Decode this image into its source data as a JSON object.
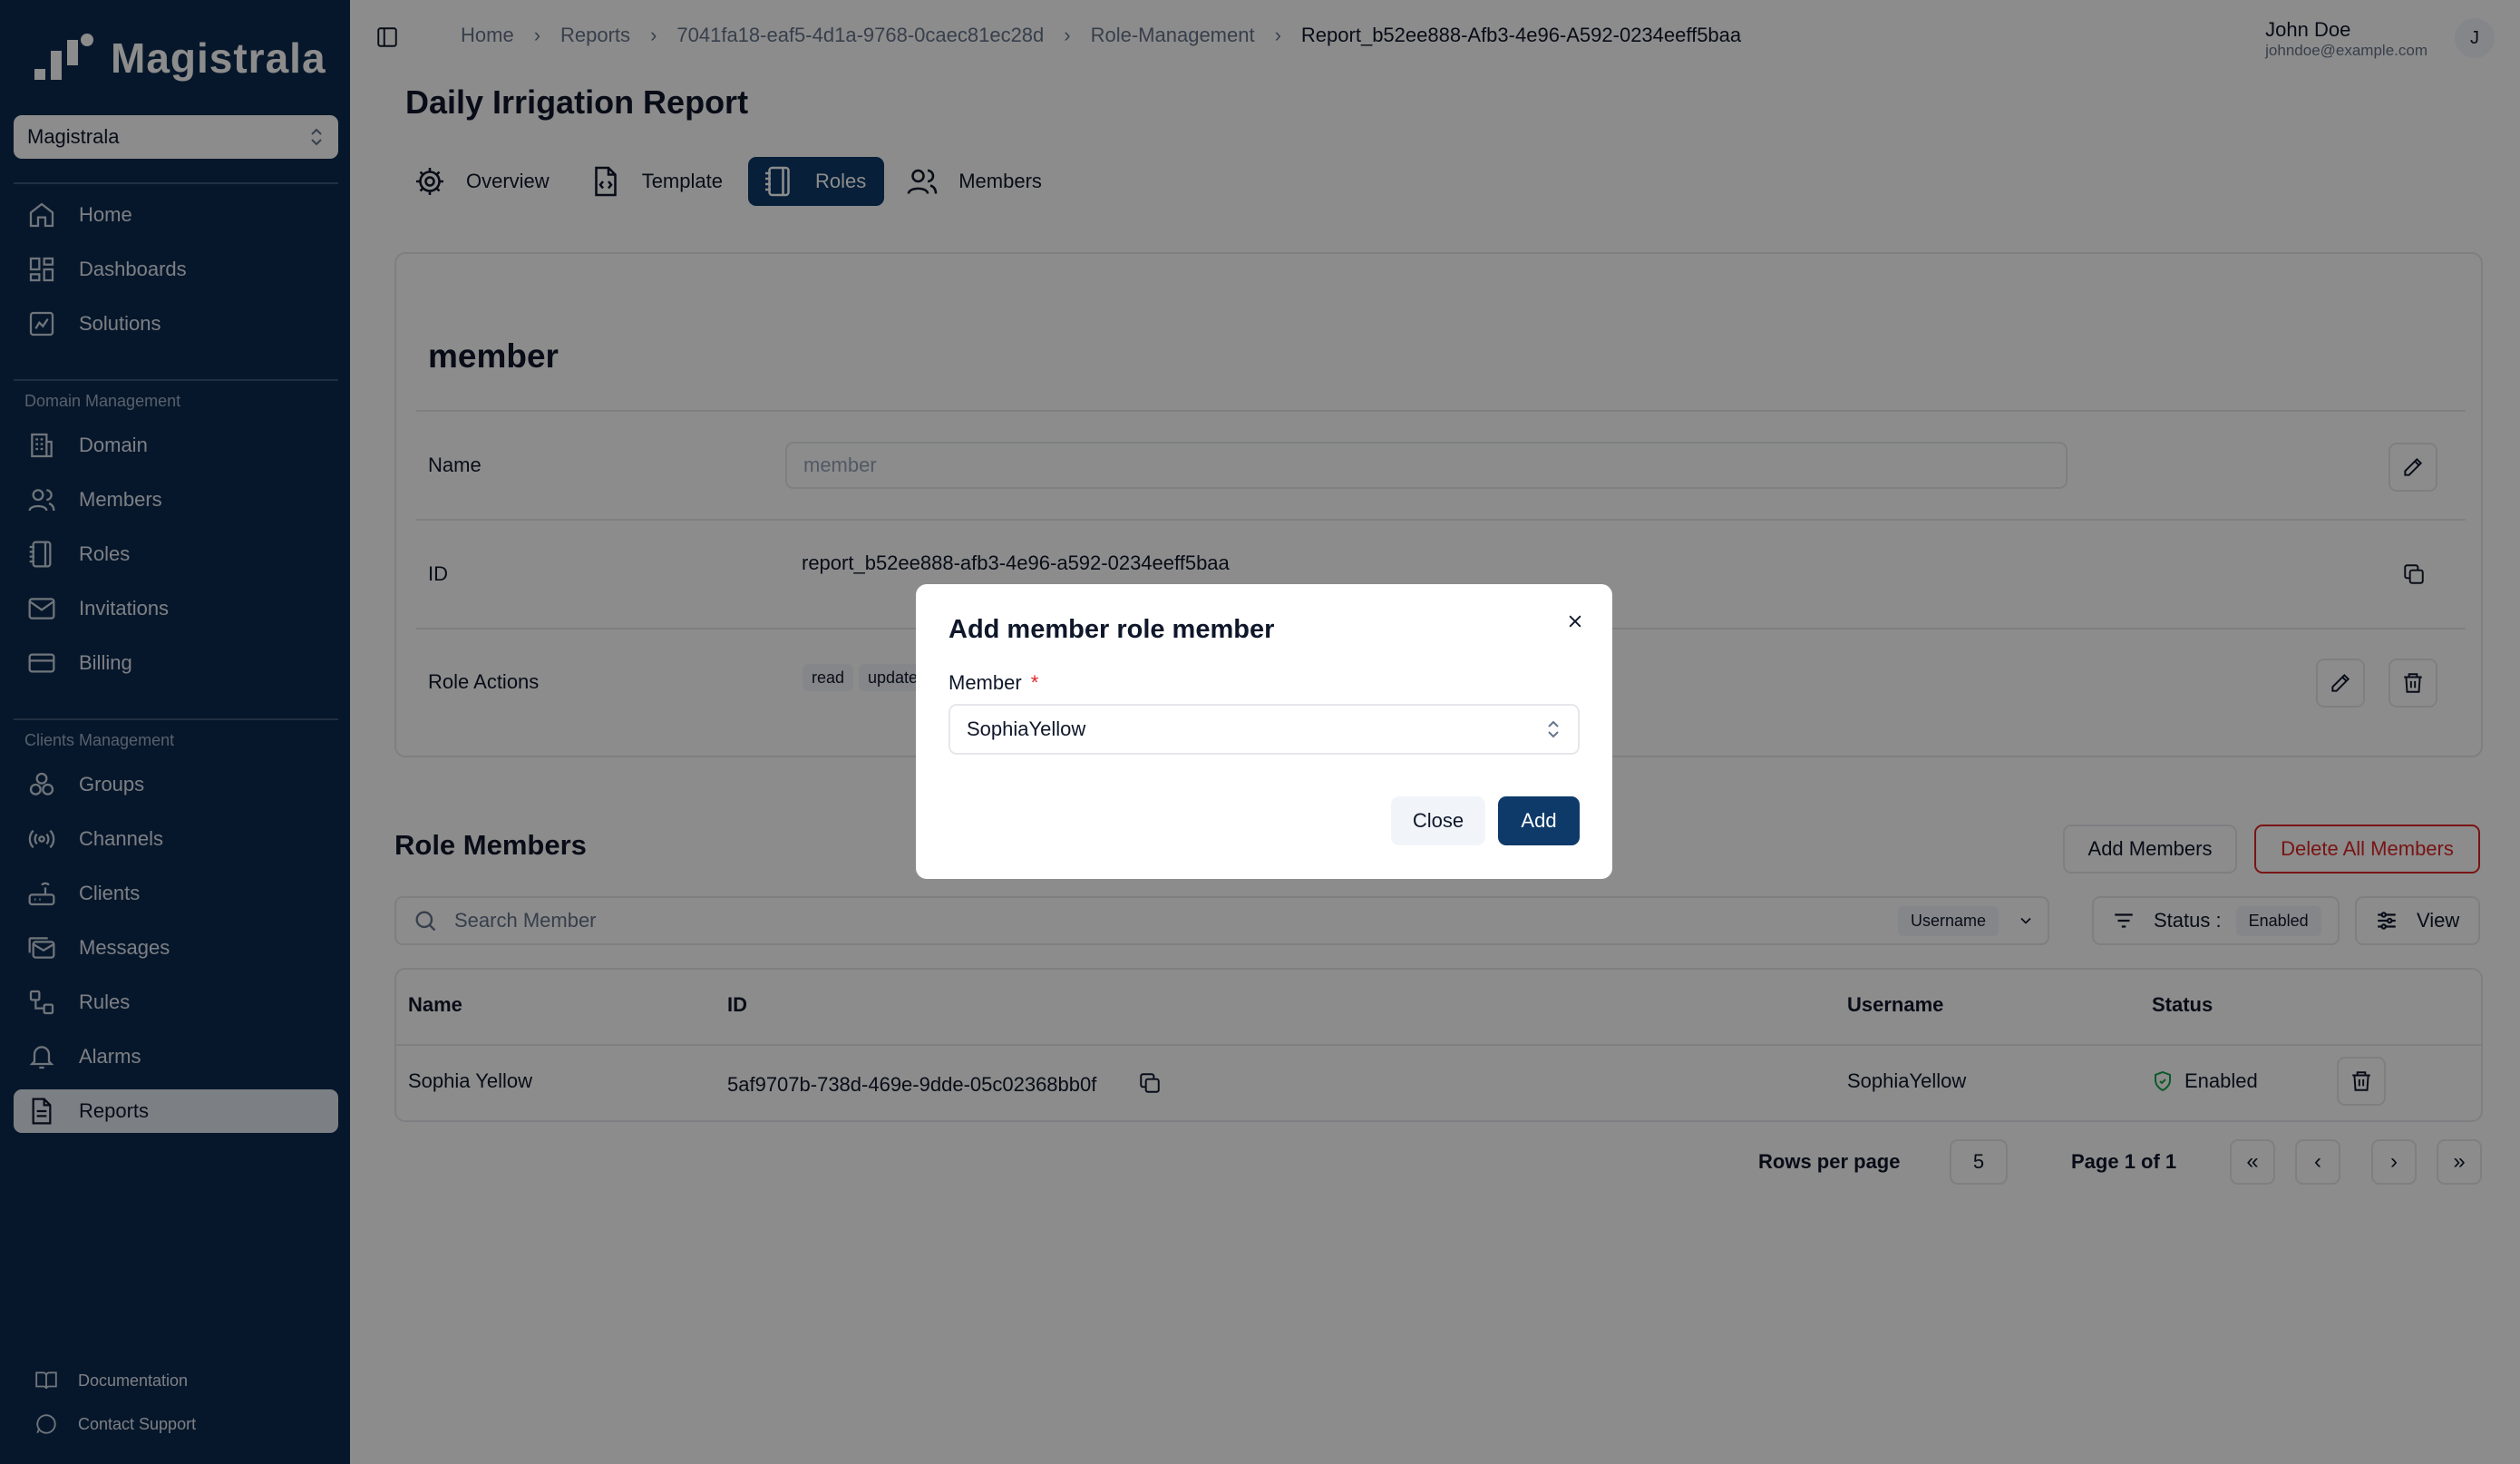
{
  "app": {
    "logo_text": "Magistrala",
    "workspace": "Magistrala"
  },
  "sidebar": {
    "main_items": [
      {
        "label": "Home",
        "icon": "home-icon"
      },
      {
        "label": "Dashboards",
        "icon": "dashboard-icon"
      },
      {
        "label": "Solutions",
        "icon": "solutions-icon"
      }
    ],
    "domain_section": "Domain Management",
    "domain_items": [
      {
        "label": "Domain",
        "icon": "building-icon"
      },
      {
        "label": "Members",
        "icon": "users-icon"
      },
      {
        "label": "Roles",
        "icon": "notebook-icon"
      },
      {
        "label": "Invitations",
        "icon": "mail-icon"
      },
      {
        "label": "Billing",
        "icon": "credit-card-icon"
      }
    ],
    "clients_section": "Clients Management",
    "clients_items": [
      {
        "label": "Groups",
        "icon": "groups-icon"
      },
      {
        "label": "Channels",
        "icon": "radio-icon"
      },
      {
        "label": "Clients",
        "icon": "router-icon"
      },
      {
        "label": "Messages",
        "icon": "mails-icon"
      },
      {
        "label": "Rules",
        "icon": "workflow-icon"
      },
      {
        "label": "Alarms",
        "icon": "bell-icon"
      },
      {
        "label": "Reports",
        "icon": "file-icon",
        "active": true
      }
    ],
    "footer": {
      "documentation": "Documentation",
      "support": "Contact Support"
    }
  },
  "header": {
    "breadcrumb": [
      "Home",
      "Reports",
      "7041fa18-eaf5-4d1a-9768-0caec81ec28d",
      "Role-Management",
      "Report_b52ee888-Afb3-4e96-A592-0234eeff5baa"
    ],
    "user_name": "John Doe",
    "user_email": "johndoe@example.com",
    "avatar_letter": "J"
  },
  "page": {
    "title": "Daily Irrigation Report",
    "tabs": [
      {
        "label": "Overview",
        "icon": "gear-icon"
      },
      {
        "label": "Template",
        "icon": "file-code-icon"
      },
      {
        "label": "Roles",
        "icon": "notebook-icon",
        "active": true
      },
      {
        "label": "Members",
        "icon": "users-icon"
      }
    ]
  },
  "role": {
    "title": "member",
    "name_label": "Name",
    "name_value": "member",
    "id_label": "ID",
    "id_value": "report_b52ee888-afb3-4e96-a592-0234eeff5baa",
    "actions_label": "Role Actions",
    "actions": [
      "read",
      "update"
    ]
  },
  "members": {
    "title": "Role Members",
    "add_button": "Add Members",
    "delete_all_button": "Delete All Members",
    "search_placeholder": "Search Member",
    "search_field": "Username",
    "status_filter_label": "Status :",
    "status_filter_value": "Enabled",
    "view_button": "View",
    "columns": [
      "Name",
      "ID",
      "Username",
      "Status"
    ],
    "rows": [
      {
        "name": "Sophia Yellow",
        "id": "5af9707b-738d-469e-9dde-05c02368bb0f",
        "username": "SophiaYellow",
        "status": "Enabled"
      }
    ],
    "rows_per_page_label": "Rows per page",
    "rows_per_page": "5",
    "page_info": "Page 1 of 1"
  },
  "modal": {
    "title": "Add member role member",
    "field_label": "Member",
    "required_mark": "*",
    "selected_value": "SophiaYellow",
    "close_button": "Close",
    "add_button": "Add"
  },
  "colors": {
    "sidebar_bg": "#0d2a4f",
    "primary": "#0d3a69",
    "danger": "#dc2626",
    "success": "#16a34a"
  }
}
